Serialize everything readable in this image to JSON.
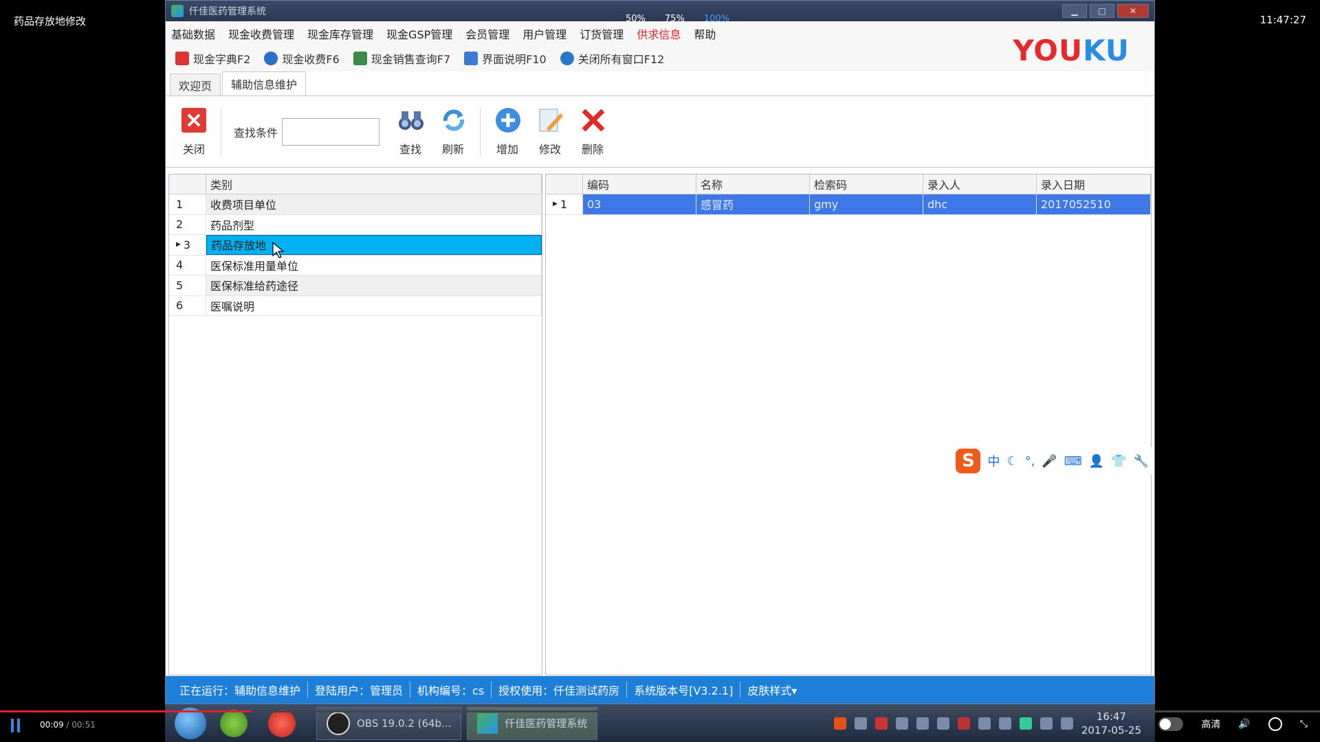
{
  "video": {
    "title": "药品存放地修改",
    "clock": "11:47:27",
    "zoom_levels": [
      "50%",
      "75%",
      "100%"
    ],
    "zoom_active": "100%"
  },
  "window": {
    "title": "仟佳医药管理系统",
    "logo_you": "YOU",
    "logo_ku": "KU"
  },
  "menu": [
    "基础数据",
    "现金收费管理",
    "现金库存管理",
    "现金GSP管理",
    "会员管理",
    "用户管理",
    "订货管理",
    "供求信息",
    "帮助"
  ],
  "menu_highlight": "供求信息",
  "quickbar": [
    {
      "label": "现金字典F2",
      "icon": "dictionary-icon",
      "color": "#d33"
    },
    {
      "label": "现金收费F6",
      "icon": "money-bag-icon",
      "color": "#2a6fc8"
    },
    {
      "label": "现金销售查询F7",
      "icon": "chart-icon",
      "color": "#3a8b4a"
    },
    {
      "label": "界面说明F10",
      "icon": "monitor-icon",
      "color": "#3b7bd0"
    },
    {
      "label": "关闭所有窗口F12",
      "icon": "close-windows-icon",
      "color": "#2a77c9"
    }
  ],
  "tabs": [
    {
      "label": "欢迎页",
      "active": false
    },
    {
      "label": "辅助信息维护",
      "active": true
    }
  ],
  "toolbar": {
    "close_label": "关闭",
    "search_label": "查找条件",
    "search_value": "",
    "find_label": "查找",
    "refresh_label": "刷新",
    "add_label": "增加",
    "edit_label": "修改",
    "delete_label": "删除"
  },
  "left_grid": {
    "header": "类别",
    "rows": [
      {
        "num": "1",
        "label": "收费项目单位",
        "selected": false
      },
      {
        "num": "2",
        "label": "药品剂型",
        "selected": false
      },
      {
        "num": "3",
        "label": "药品存放地",
        "selected": true
      },
      {
        "num": "4",
        "label": "医保标准用量单位",
        "selected": false
      },
      {
        "num": "5",
        "label": "医保标准给药途径",
        "selected": false
      },
      {
        "num": "6",
        "label": "医嘱说明",
        "selected": false
      }
    ]
  },
  "right_grid": {
    "headers": [
      "编码",
      "名称",
      "检索码",
      "录入人",
      "录入日期"
    ],
    "rows": [
      {
        "num": "1",
        "cells": [
          "03",
          "感冒药",
          "gmy",
          "dhc",
          "2017052510"
        ]
      }
    ]
  },
  "status": {
    "running": "正在运行：辅助信息维护",
    "user": "登陆用户：管理员",
    "org": "机构编号：cs",
    "license": "授权使用：仟佳测试药房",
    "version": "系统版本号[V3.2.1]",
    "skin": "皮肤样式▾"
  },
  "ime": {
    "logo": "S",
    "mode": "中"
  },
  "taskbar": {
    "task1": "OBS 19.0.2 (64b...",
    "task2": "仟佳医药管理系统",
    "time": "16:47",
    "date": "2017-05-25"
  },
  "player": {
    "elapsed": "00:09",
    "duration": "00:51",
    "quality": "高清",
    "progress": 0.19
  }
}
